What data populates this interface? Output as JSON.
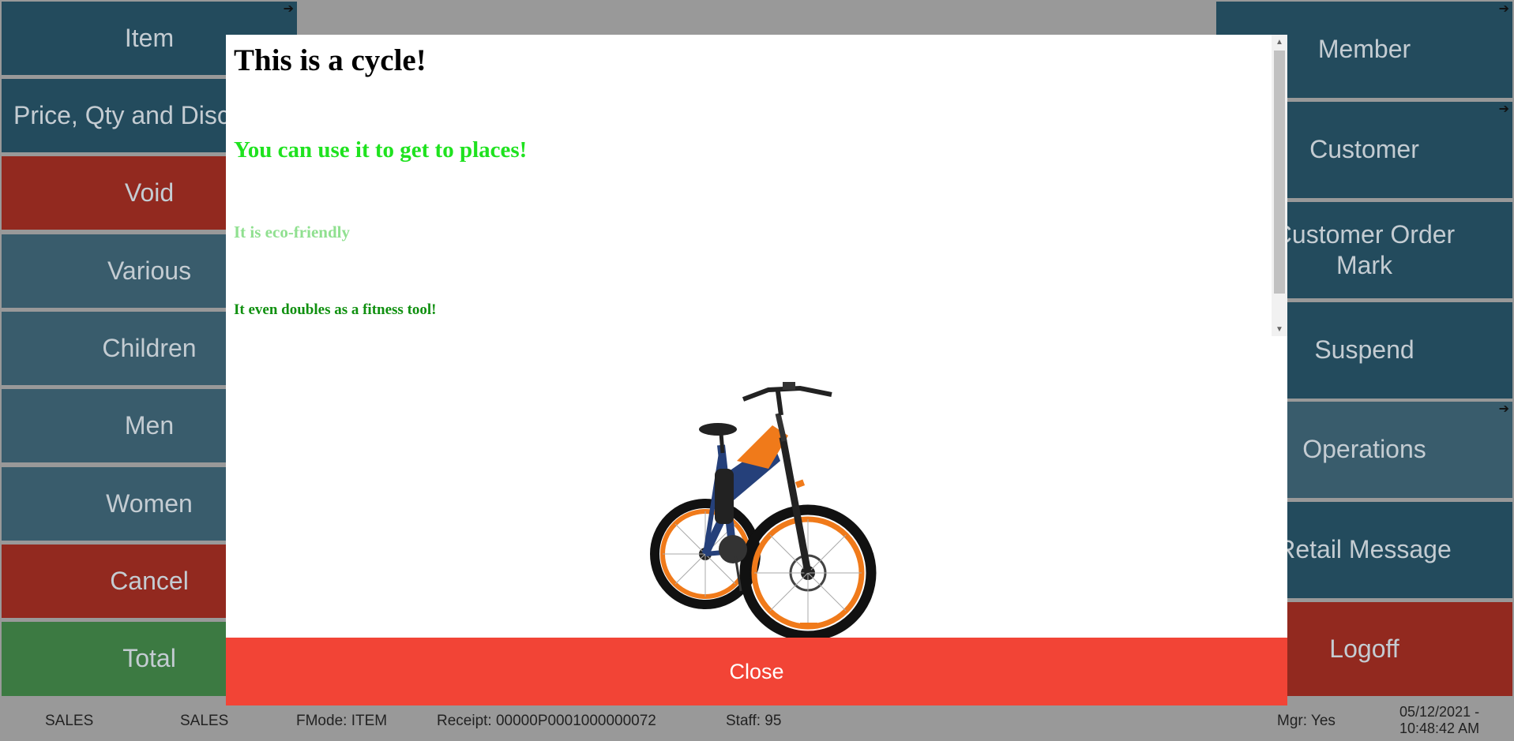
{
  "left_panel": {
    "items": [
      {
        "label": "Item",
        "arrow": "➔"
      },
      {
        "label": "Price, Qty and Discount"
      },
      {
        "label": "Void"
      },
      {
        "label": "Various"
      },
      {
        "label": "Children"
      },
      {
        "label": "Men"
      },
      {
        "label": "Women"
      },
      {
        "label": "Cancel"
      },
      {
        "label": "Total"
      }
    ]
  },
  "right_panel": {
    "items": [
      {
        "label": "Member",
        "arrow": "➔"
      },
      {
        "label": "Customer",
        "arrow": "➔"
      },
      {
        "label": "Customer Order Mark"
      },
      {
        "label": "Suspend"
      },
      {
        "label": "Operations",
        "arrow": "➔"
      },
      {
        "label": "Retail Message"
      },
      {
        "label": "Logoff"
      }
    ]
  },
  "modal": {
    "title": "This is a cycle!",
    "line1": "You can use it to get to places!",
    "line2": "It is eco-friendly",
    "line3": "It even doubles as a fitness tool!",
    "image": "bicycle-image",
    "close_label": "Close"
  },
  "status_bar": {
    "mode1": "SALES",
    "mode2": "SALES",
    "fmode": "FMode: ITEM",
    "receipt": "Receipt: 00000P0001000000072",
    "staff": "Staff: 95",
    "mgr": "Mgr: Yes",
    "date": "05/12/2021 -",
    "time": "10:48:42 AM"
  },
  "colors": {
    "tile_dark": "#234b5d",
    "tile_slate": "#395c6c",
    "tile_red": "#92291f",
    "tile_green": "#3c7a42",
    "close_button": "#f24436",
    "text_green_bright": "#1fe21f",
    "text_green_light": "#90e090",
    "text_green_dark": "#109010"
  }
}
